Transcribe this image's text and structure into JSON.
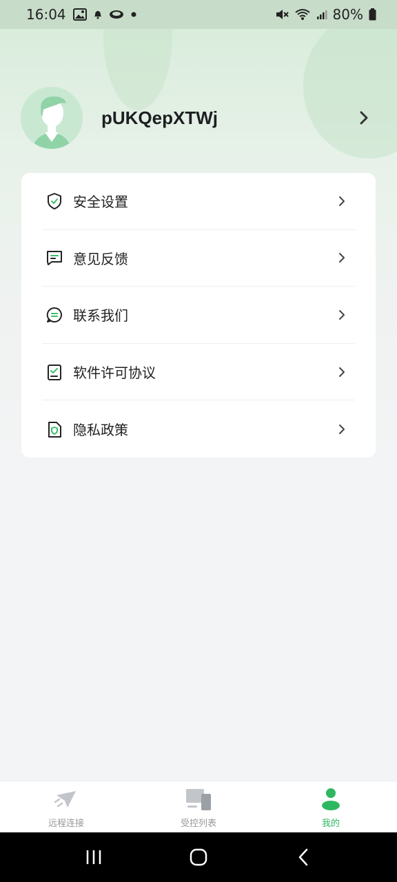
{
  "status_bar": {
    "time": "16:04",
    "battery": "80%"
  },
  "profile": {
    "username": "pUKQepXTWj"
  },
  "menu": {
    "items": [
      {
        "label": "安全设置",
        "icon": "shield-check-icon"
      },
      {
        "label": "意见反馈",
        "icon": "feedback-message-icon"
      },
      {
        "label": "联系我们",
        "icon": "chat-bubble-icon"
      },
      {
        "label": "软件许可协议",
        "icon": "license-document-icon"
      },
      {
        "label": "隐私政策",
        "icon": "privacy-document-icon"
      }
    ]
  },
  "tabs": [
    {
      "label": "远程连接",
      "icon": "send-plane-icon",
      "active": false
    },
    {
      "label": "受控列表",
      "icon": "devices-icon",
      "active": false
    },
    {
      "label": "我的",
      "icon": "person-icon",
      "active": true
    }
  ],
  "colors": {
    "accent": "#2fb760",
    "icon_green": "#3bbf6a"
  }
}
